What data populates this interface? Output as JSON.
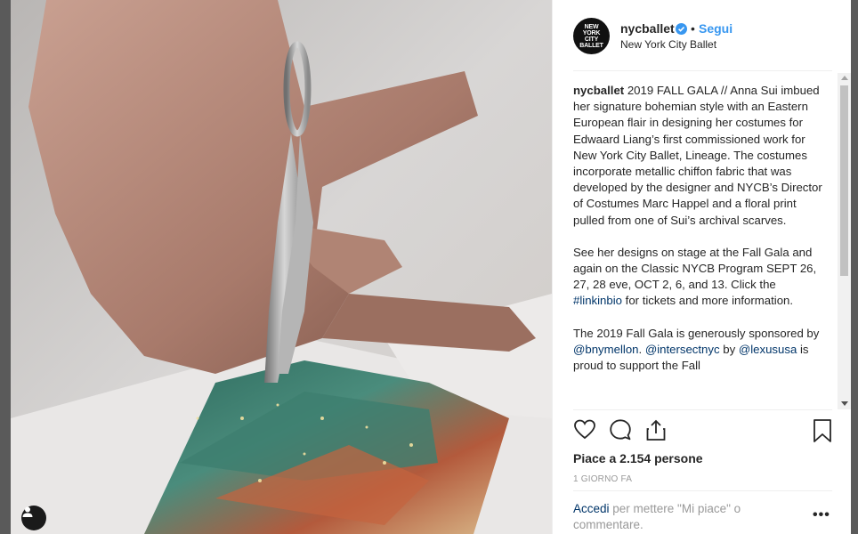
{
  "post": {
    "username": "nycballet",
    "dot": "•",
    "follow_label": "Segui",
    "subtitle": "New York City Ballet",
    "avatar_text_1": "NEW",
    "avatar_text_2": "YORK",
    "avatar_text_3": "CITY",
    "avatar_text_4": "BALLET",
    "caption": {
      "username": "nycballet",
      "p1": "2019 FALL GALA // Anna Sui imbued her signature bohemian style with an Eastern European flair in designing her costumes for Edwaard Liang’s first commissioned work for New York City Ballet, Lineage. The costumes incorporate metallic chiffon fabric that was developed by the designer and NYCB’s Director of Costumes Marc Happel and a floral print pulled from one of Sui’s archival scarves.",
      "p2_before": "See her designs on stage at the Fall Gala and again on the Classic NYCB Program SEPT 26, 27, 28 eve, OCT 2, 6, and 13. Click the ",
      "p2_link": "#linkinbio",
      "p2_after": " for tickets and more information.",
      "p3_before": "The 2019 Fall Gala is generously sponsored by ",
      "p3_link1": "@bnymellon",
      "p3_mid1": ". ",
      "p3_link2": "@intersectnyc",
      "p3_mid2": " by ",
      "p3_link3": "@lexususa",
      "p3_after": " is proud to support the Fall"
    },
    "likes": "Piace a 2.154 persone",
    "time": "1 GIORNO FA",
    "login_link": "Accedi",
    "login_text": " per mettere \"Mi piace\" o commentare.",
    "more": "•••"
  },
  "icons": {
    "verified": "verified-badge-icon",
    "like": "heart-icon",
    "comment": "comment-icon",
    "share": "share-icon",
    "save": "bookmark-icon",
    "user_tag": "user-icon"
  },
  "colors": {
    "follow": "#3897f0",
    "link": "#003569",
    "muted": "#999999",
    "text": "#262626"
  }
}
